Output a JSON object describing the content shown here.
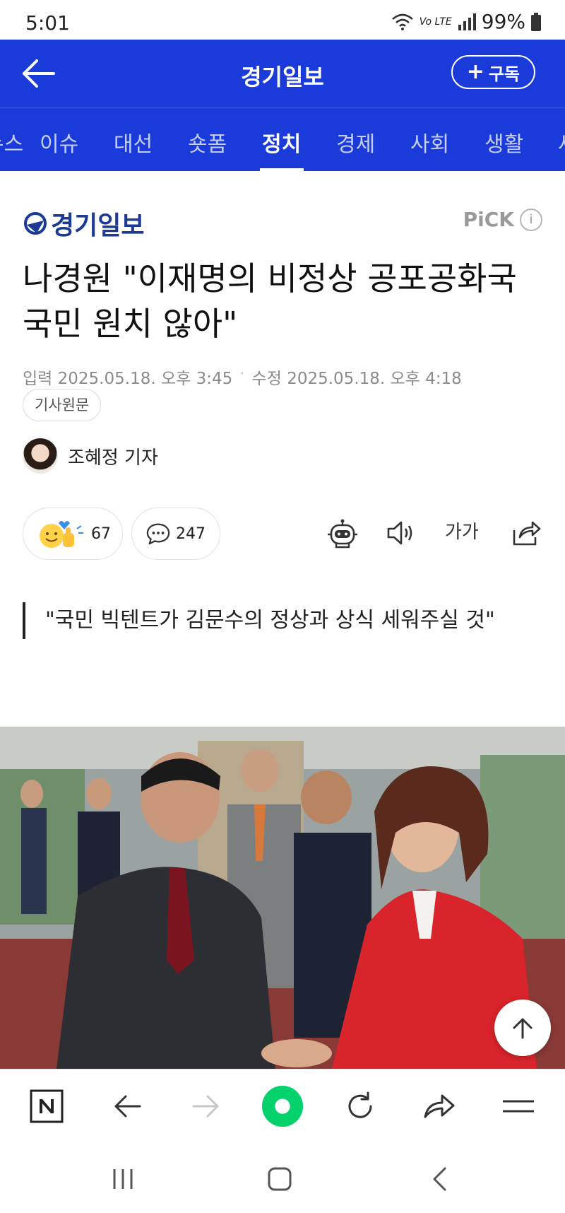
{
  "status_bar": {
    "time": "5:01",
    "network": "Vo LTE",
    "battery": "99%"
  },
  "header": {
    "title": "경기일보",
    "subscribe_label": "구독"
  },
  "tabs": [
    "뉴스",
    "이슈",
    "대선",
    "숏폼",
    "정치",
    "경제",
    "사회",
    "생활",
    "세계"
  ],
  "active_tab": "정치",
  "press": {
    "name": "경기일보",
    "badge": "PiCK"
  },
  "article": {
    "headline": "나경원 \"이재명의 비정상 공포공화국 국민 원치 않아\"",
    "input_label": "입력",
    "input_date": "2025.05.18. 오후 3:45",
    "modified_label": "수정",
    "modified_date": "2025.05.18. 오후 4:18",
    "original_label": "기사원문",
    "reporter": "조혜정 기자",
    "reaction_count": "67",
    "comment_count": "247",
    "font_size_label": "가가",
    "subtitle": "\"국민 빅텐트가 김문수의 정상과 상식 세워주실 것\""
  },
  "colors": {
    "brand_blue": "#1a3bd9",
    "press_logo": "#1c3a94",
    "naver_green": "#03d26c"
  }
}
